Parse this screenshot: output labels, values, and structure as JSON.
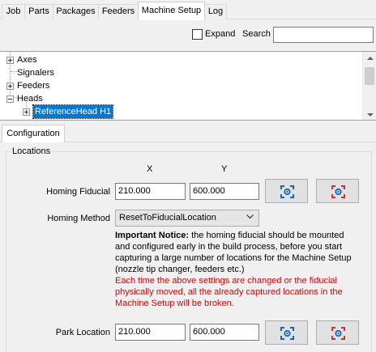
{
  "tabs": [
    {
      "label": "Job",
      "active": false
    },
    {
      "label": "Parts",
      "active": false
    },
    {
      "label": "Packages",
      "active": false
    },
    {
      "label": "Feeders",
      "active": false
    },
    {
      "label": "Machine Setup",
      "active": true
    },
    {
      "label": "Log",
      "active": false
    }
  ],
  "toolbar": {
    "expand_label": "Expand",
    "expand_checked": false,
    "search_label": "Search",
    "search_value": ""
  },
  "tree": {
    "items": [
      {
        "label": "Axes",
        "expander": "plus",
        "level": 0
      },
      {
        "label": "Signalers",
        "expander": "none",
        "level": 0
      },
      {
        "label": "Feeders",
        "expander": "plus",
        "level": 0
      },
      {
        "label": "Heads",
        "expander": "minus",
        "level": 0
      },
      {
        "label": "ReferenceHead H1",
        "expander": "plus",
        "level": 1,
        "selected": true
      }
    ]
  },
  "config_tab": {
    "label": "Configuration"
  },
  "locations": {
    "group_title": "Locations",
    "col_x": "X",
    "col_y": "Y",
    "homing_fiducial_label": "Homing Fiducial",
    "homing_fiducial_x": "210.000",
    "homing_fiducial_y": "600.000",
    "homing_method_label": "Homing Method",
    "homing_method_value": "ResetToFiducialLocation",
    "notice_bold": "Important Notice:",
    "notice_text": " the homing fiducial should be mounted and configured early in the build process, before you start capturing a large number of locations for the Machine Setup (nozzle tip changer, feeders etc.)",
    "warning_text": "Each time the above settings are changed or the fiducial physically moved, all the already captured locations in the Machine Setup will be broken.",
    "park_location_label": "Park Location",
    "park_location_x": "210.000",
    "park_location_y": "600.000"
  },
  "icons": {
    "capture_camera": "capture-camera-icon",
    "capture_tool": "capture-tool-icon"
  },
  "colors": {
    "selection": "#0078d7",
    "warning": "#e00000",
    "camera_icon": "#1565c0",
    "tool_icon": "#d32f2f"
  }
}
